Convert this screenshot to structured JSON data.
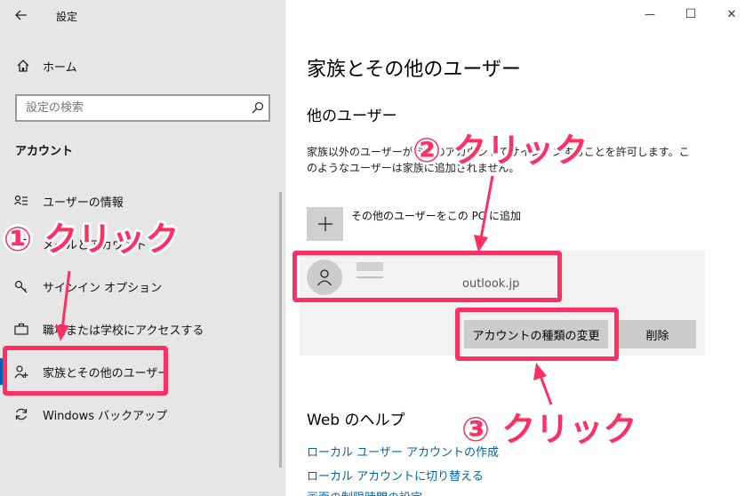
{
  "window": {
    "title": "設定",
    "back_icon": "back-arrow-icon",
    "minimize_glyph": "—",
    "maximize_glyph": "☐",
    "close_glyph": "✕"
  },
  "sidebar": {
    "home_label": "ホーム",
    "search_placeholder": "設定の検索",
    "section_title": "アカウント",
    "items": [
      {
        "label": "ユーザーの情報",
        "icon": "user-info-icon"
      },
      {
        "label": "メールとアカウント",
        "icon": "mail-icon"
      },
      {
        "label": "サインイン オプション",
        "icon": "key-icon"
      },
      {
        "label": "職場または学校にアクセスする",
        "icon": "briefcase-icon"
      },
      {
        "label": "家族とその他のユーザー",
        "icon": "add-person-icon",
        "selected": true
      },
      {
        "label": "Windows バックアップ",
        "icon": "sync-icon"
      }
    ]
  },
  "main": {
    "page_title": "家族とその他のユーザー",
    "section_title": "他のユーザー",
    "description_line1": "家族以外のユーザーが自分のアカウントでサインインすることを許可します。こ",
    "description_line2": "のようなユーザーは家族に追加されません。",
    "add_user_label": "その他のユーザーをこの PC に追加",
    "user_email": "outlook.jp",
    "change_type_button": "アカウントの種類の変更",
    "delete_button": "削除",
    "help_title": "Web のヘルプ",
    "help_links": [
      "ローカル ユーザー アカウントの作成",
      "ローカル アカウントに切り替える",
      "画面の制限時間の設定"
    ]
  },
  "annotations": {
    "step1": "① クリック",
    "step2": "② クリック",
    "step3": "③ クリック"
  },
  "colors": {
    "accent": "#0063b1",
    "highlight": "#ff2e63",
    "sidebar_bg": "#e6e6e6"
  }
}
